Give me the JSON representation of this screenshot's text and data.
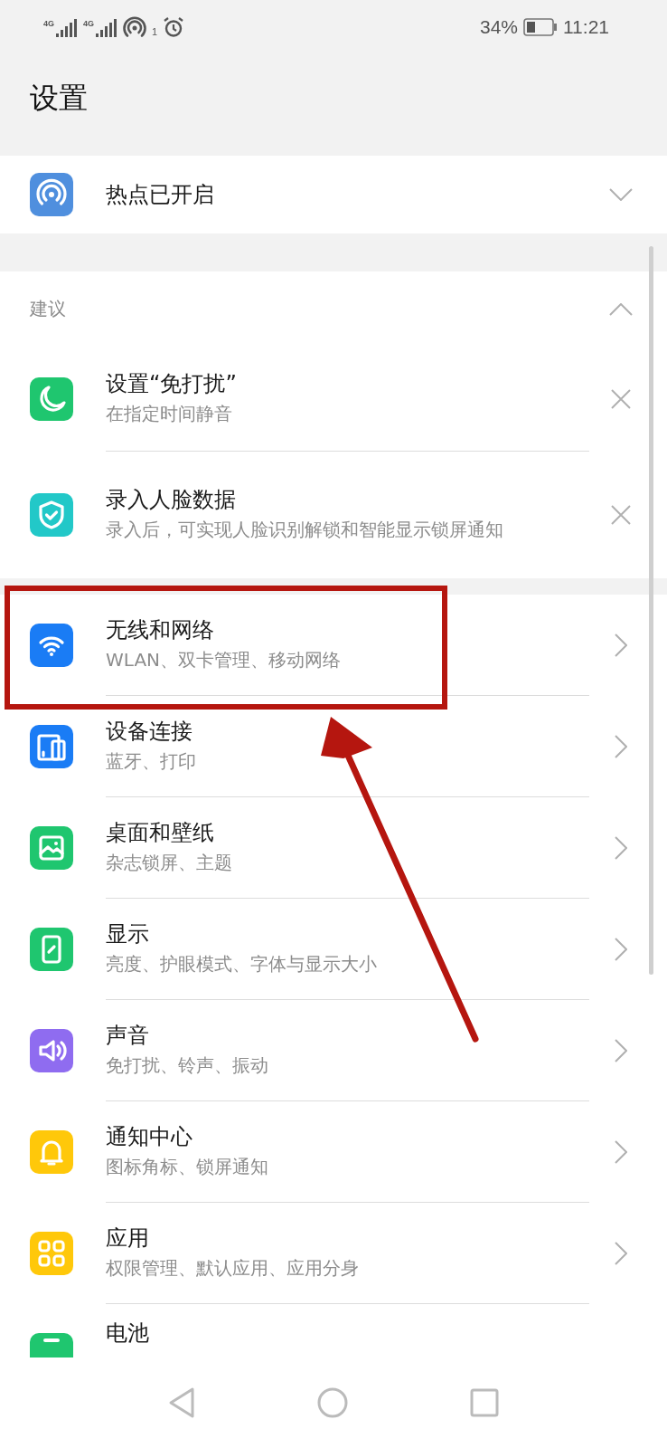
{
  "status_bar": {
    "signals": [
      {
        "label": "4G"
      },
      {
        "label": "4G"
      }
    ],
    "hotspot_count": "1",
    "battery_text": "34%",
    "time": "11:21"
  },
  "header": {
    "title": "设置"
  },
  "hotspot": {
    "title": "热点已开启",
    "color": "#4f8fde",
    "expanded": false
  },
  "suggestions": {
    "label": "建议",
    "expanded": true,
    "items": [
      {
        "title": "设置“免打扰”",
        "subtitle": "在指定时间静音",
        "color": "#1fc66f"
      },
      {
        "title": "录入人脸数据",
        "subtitle": "录入后，可实现人脸识别解锁和智能显示锁屏通知",
        "color": "#22c8c8"
      }
    ]
  },
  "menu": [
    {
      "title": "无线和网络",
      "subtitle": "WLAN、双卡管理、移动网络",
      "color": "#1a7cf5",
      "highlighted": true
    },
    {
      "title": "设备连接",
      "subtitle": "蓝牙、打印",
      "color": "#1a7cf5",
      "highlighted": false
    },
    {
      "title": "桌面和壁纸",
      "subtitle": "杂志锁屏、主题",
      "color": "#1fc66f",
      "highlighted": false
    },
    {
      "title": "显示",
      "subtitle": "亮度、护眼模式、字体与显示大小",
      "color": "#1fc66f",
      "highlighted": false
    },
    {
      "title": "声音",
      "subtitle": "免打扰、铃声、振动",
      "color": "#8f6cf0",
      "highlighted": false
    },
    {
      "title": "通知中心",
      "subtitle": "图标角标、锁屏通知",
      "color": "#ffc80a",
      "highlighted": false
    },
    {
      "title": "应用",
      "subtitle": "权限管理、默认应用、应用分身",
      "color": "#ffc80a",
      "highlighted": false
    },
    {
      "title": "电池",
      "color": "#1fc66f",
      "highlighted": false
    }
  ]
}
